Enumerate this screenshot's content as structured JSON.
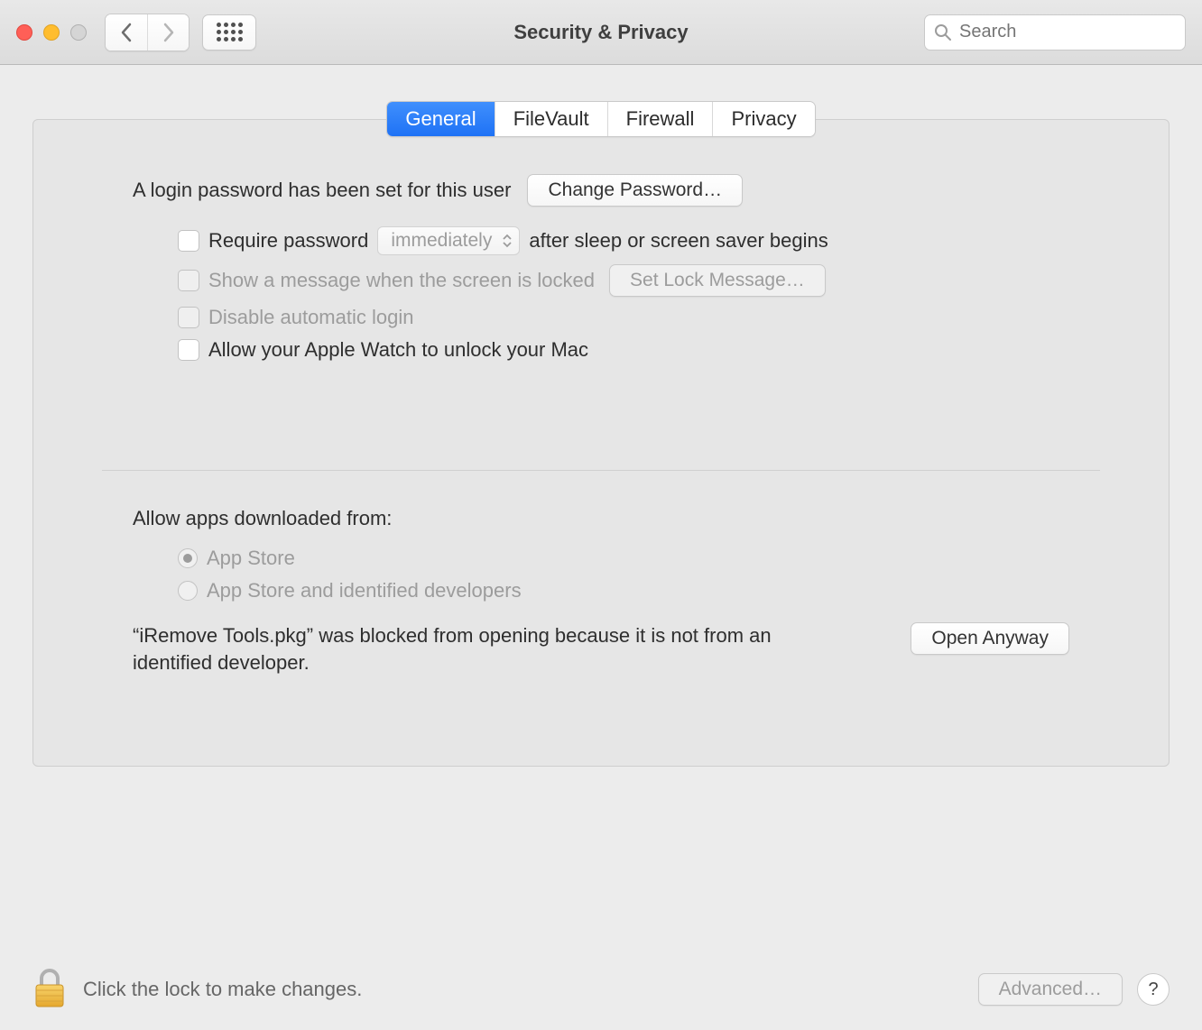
{
  "header": {
    "title": "Security & Privacy",
    "search_placeholder": "Search"
  },
  "tabs": {
    "general": "General",
    "filevault": "FileVault",
    "firewall": "Firewall",
    "privacy": "Privacy"
  },
  "general": {
    "login_password_set": "A login password has been set for this user",
    "change_password_btn": "Change Password…",
    "require_password_label": "Require password",
    "require_password_delay": "immediately",
    "require_password_suffix": "after sleep or screen saver begins",
    "show_lock_message_label": "Show a message when the screen is locked",
    "set_lock_message_btn": "Set Lock Message…",
    "disable_auto_login_label": "Disable automatic login",
    "apple_watch_unlock_label": "Allow your Apple Watch to unlock your Mac",
    "allow_apps_title": "Allow apps downloaded from:",
    "radio_app_store": "App Store",
    "radio_app_store_and_dev": "App Store and identified developers",
    "blocked_message": "“iRemove Tools.pkg” was blocked from opening because it is not from an identified developer.",
    "open_anyway_btn": "Open Anyway"
  },
  "footer": {
    "lock_text": "Click the lock to make changes.",
    "advanced_btn": "Advanced…",
    "help_btn": "?"
  }
}
